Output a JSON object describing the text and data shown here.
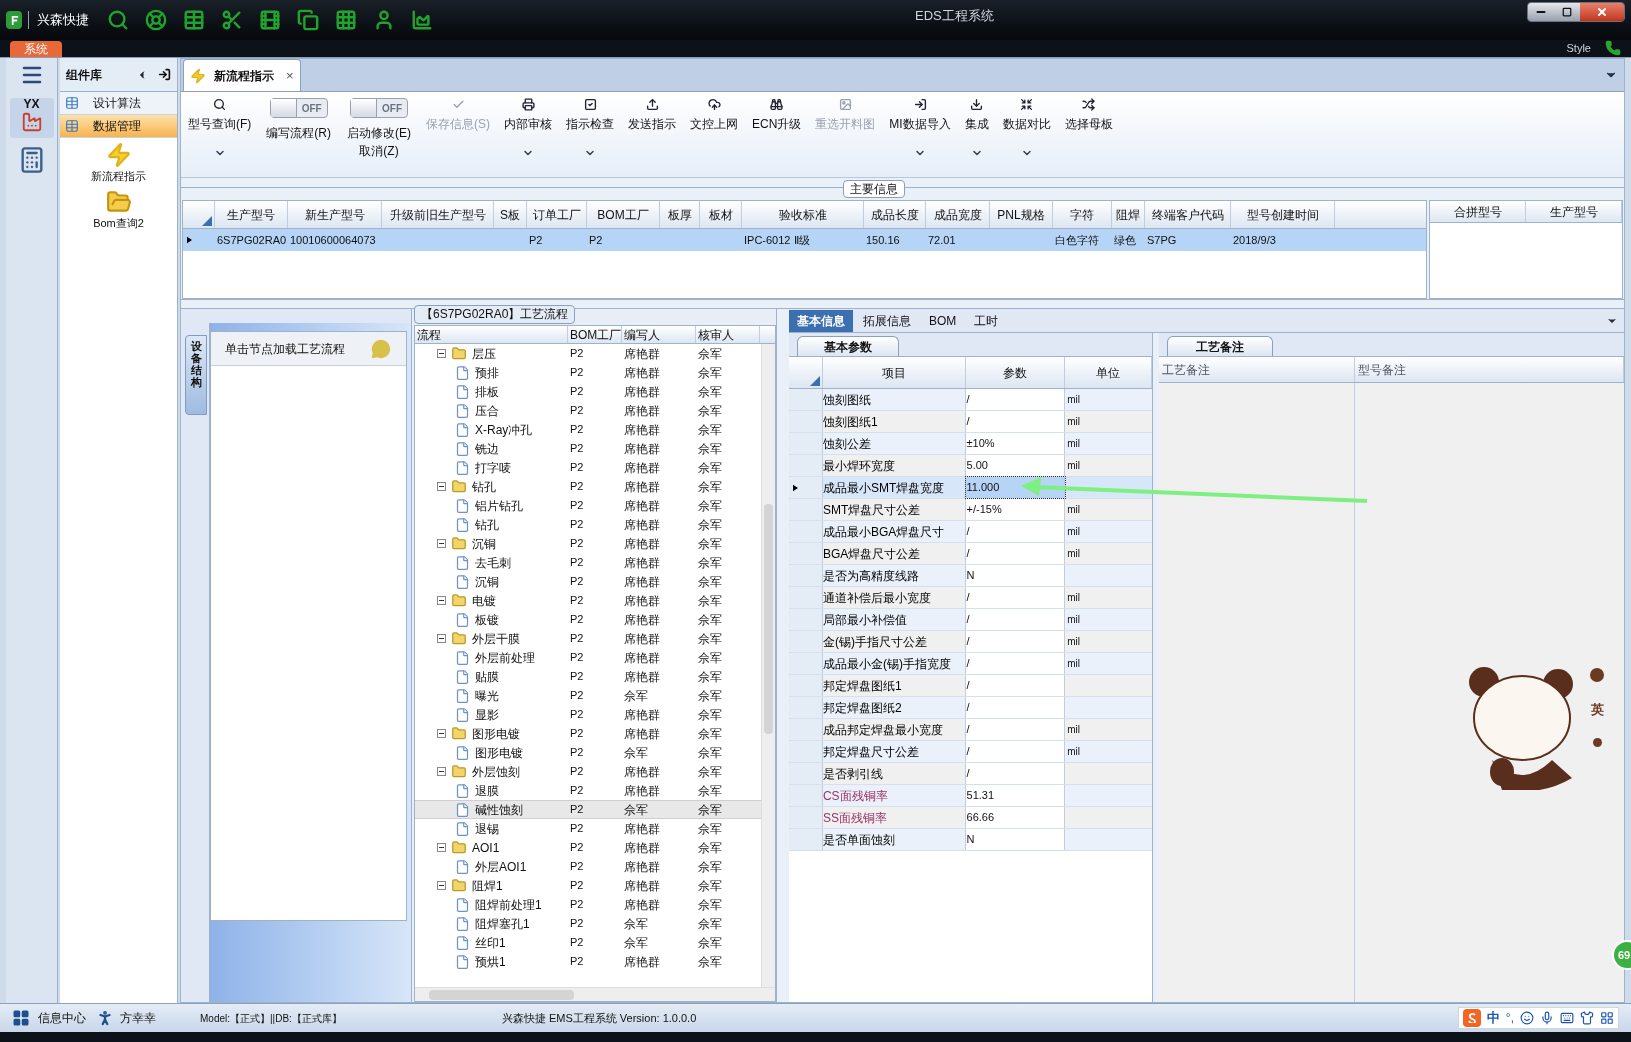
{
  "app": {
    "name": "兴森快捷",
    "window_title": "EDS工程系统",
    "system_tab": "系统",
    "style_label": "Style"
  },
  "left_rail": {
    "logo_text": "YX"
  },
  "sidebar": {
    "title": "组件库",
    "items": [
      {
        "label": "设计算法",
        "selected": false
      },
      {
        "label": "数据管理",
        "selected": true
      }
    ],
    "tools": [
      "新流程指示",
      "Bom查询2"
    ]
  },
  "doc_tab": {
    "label": "新流程指示",
    "close": "×"
  },
  "toolbar": [
    {
      "kind": "button",
      "label": "型号查询(F)",
      "disabled": false,
      "dropdown": true
    },
    {
      "kind": "toggle",
      "label": "编写流程(R)",
      "on": false,
      "state_text": "OFF"
    },
    {
      "kind": "toggle",
      "label": "启动修改(E)",
      "sublabel": "取消(Z)",
      "on": false,
      "state_text": "OFF"
    },
    {
      "kind": "button",
      "label": "保存信息(S)",
      "disabled": true,
      "dropdown": false
    },
    {
      "kind": "button",
      "label": "内部审核",
      "disabled": false,
      "dropdown": true
    },
    {
      "kind": "button",
      "label": "指示检查",
      "disabled": false,
      "dropdown": true
    },
    {
      "kind": "button",
      "label": "发送指示",
      "disabled": false,
      "dropdown": false
    },
    {
      "kind": "button",
      "label": "文控上网",
      "disabled": false,
      "dropdown": false
    },
    {
      "kind": "button",
      "label": "ECN升级",
      "disabled": false,
      "dropdown": false
    },
    {
      "kind": "button",
      "label": "重选开料图",
      "disabled": true,
      "dropdown": false
    },
    {
      "kind": "button",
      "label": "MI数据导入",
      "disabled": false,
      "dropdown": true
    },
    {
      "kind": "button",
      "label": "集成",
      "disabled": false,
      "dropdown": true
    },
    {
      "kind": "button",
      "label": "数据对比",
      "disabled": false,
      "dropdown": true
    },
    {
      "kind": "button",
      "label": "选择母板",
      "disabled": false,
      "dropdown": false
    }
  ],
  "main_info": {
    "title": "主要信息",
    "columns": [
      "生产型号",
      "新生产型号",
      "升级前旧生产型号",
      "S板",
      "订单工厂",
      "BOM工厂",
      "板厚",
      "板材",
      "验收标准",
      "成品长度",
      "成品宽度",
      "PNL规格",
      "字符",
      "阻焊",
      "终端客户代码",
      "型号创建时间"
    ],
    "rows": [
      {
        "selected": true,
        "cells": [
          "6S7PG02RA0",
          "10010600064073",
          null,
          null,
          "P2",
          "P2",
          null,
          null,
          "IPC-6012 Ⅱ级",
          "150.16",
          "72.01",
          null,
          "白色字符",
          "绿色",
          "S7PG",
          "2018/9/3"
        ]
      }
    ],
    "side_columns": [
      "合拼型号",
      "生产型号"
    ]
  },
  "process": {
    "side_tab": "设备结构",
    "hint": "单击节点加载工艺流程",
    "title": "【6S7PG02RA0】工艺流程",
    "columns": [
      "流程",
      "BOM工厂",
      "编写人",
      "核审人"
    ],
    "nodes": [
      {
        "label": "层压",
        "bom": "P2",
        "writer": "席艳群",
        "reviewer": "佘军",
        "expanded": true,
        "selected": false,
        "children": [
          {
            "label": "预排",
            "bom": "P2",
            "writer": "席艳群",
            "reviewer": "佘军",
            "selected": false
          },
          {
            "label": "排板",
            "bom": "P2",
            "writer": "席艳群",
            "reviewer": "佘军",
            "selected": false
          },
          {
            "label": "压合",
            "bom": "P2",
            "writer": "席艳群",
            "reviewer": "佘军",
            "selected": false
          },
          {
            "label": "X-Ray冲孔",
            "bom": "P2",
            "writer": "席艳群",
            "reviewer": "佘军",
            "selected": false
          },
          {
            "label": "铣边",
            "bom": "P2",
            "writer": "席艳群",
            "reviewer": "佘军",
            "selected": false
          },
          {
            "label": "打字唛",
            "bom": "P2",
            "writer": "席艳群",
            "reviewer": "佘军",
            "selected": false
          }
        ]
      },
      {
        "label": "钻孔",
        "bom": "P2",
        "writer": "席艳群",
        "reviewer": "佘军",
        "expanded": true,
        "selected": false,
        "children": [
          {
            "label": "铝片钻孔",
            "bom": "P2",
            "writer": "席艳群",
            "reviewer": "佘军",
            "selected": false
          },
          {
            "label": "钻孔",
            "bom": "P2",
            "writer": "席艳群",
            "reviewer": "佘军",
            "selected": false
          }
        ]
      },
      {
        "label": "沉铜",
        "bom": "P2",
        "writer": "席艳群",
        "reviewer": "佘军",
        "expanded": true,
        "selected": false,
        "children": [
          {
            "label": "去毛刺",
            "bom": "P2",
            "writer": "席艳群",
            "reviewer": "佘军",
            "selected": false
          },
          {
            "label": "沉铜",
            "bom": "P2",
            "writer": "席艳群",
            "reviewer": "佘军",
            "selected": false
          }
        ]
      },
      {
        "label": "电镀",
        "bom": "P2",
        "writer": "席艳群",
        "reviewer": "佘军",
        "expanded": true,
        "selected": false,
        "children": [
          {
            "label": "板镀",
            "bom": "P2",
            "writer": "席艳群",
            "reviewer": "佘军",
            "selected": false
          }
        ]
      },
      {
        "label": "外层干膜",
        "bom": "P2",
        "writer": "席艳群",
        "reviewer": "佘军",
        "expanded": true,
        "selected": false,
        "children": [
          {
            "label": "外层前处理",
            "bom": "P2",
            "writer": "席艳群",
            "reviewer": "佘军",
            "selected": false
          },
          {
            "label": "贴膜",
            "bom": "P2",
            "writer": "席艳群",
            "reviewer": "佘军",
            "selected": false
          },
          {
            "label": "曝光",
            "bom": "P2",
            "writer": "佘军",
            "reviewer": "佘军",
            "selected": false
          },
          {
            "label": "显影",
            "bom": "P2",
            "writer": "席艳群",
            "reviewer": "佘军",
            "selected": false
          }
        ]
      },
      {
        "label": "图形电镀",
        "bom": "P2",
        "writer": "席艳群",
        "reviewer": "佘军",
        "expanded": true,
        "selected": false,
        "children": [
          {
            "label": "图形电镀",
            "bom": "P2",
            "writer": "佘军",
            "reviewer": "佘军",
            "selected": false
          }
        ]
      },
      {
        "label": "外层蚀刻",
        "bom": "P2",
        "writer": "席艳群",
        "reviewer": "佘军",
        "expanded": true,
        "selected": false,
        "children": [
          {
            "label": "退膜",
            "bom": "P2",
            "writer": "席艳群",
            "reviewer": "佘军",
            "selected": false
          },
          {
            "label": "碱性蚀刻",
            "bom": "P2",
            "writer": "佘军",
            "reviewer": "佘军",
            "selected": true
          },
          {
            "label": "退锡",
            "bom": "P2",
            "writer": "席艳群",
            "reviewer": "佘军",
            "selected": false
          }
        ]
      },
      {
        "label": "AOI1",
        "bom": "P2",
        "writer": "席艳群",
        "reviewer": "佘军",
        "expanded": true,
        "selected": false,
        "children": [
          {
            "label": "外层AOI1",
            "bom": "P2",
            "writer": "席艳群",
            "reviewer": "佘军",
            "selected": false
          }
        ]
      },
      {
        "label": "阻焊1",
        "bom": "P2",
        "writer": "席艳群",
        "reviewer": "佘军",
        "expanded": true,
        "selected": false,
        "children": [
          {
            "label": "阻焊前处理1",
            "bom": "P2",
            "writer": "席艳群",
            "reviewer": "佘军",
            "selected": false
          },
          {
            "label": "阻焊塞孔1",
            "bom": "P2",
            "writer": "佘军",
            "reviewer": "佘军",
            "selected": false
          },
          {
            "label": "丝印1",
            "bom": "P2",
            "writer": "佘军",
            "reviewer": "佘军",
            "selected": false
          },
          {
            "label": "预烘1",
            "bom": "P2",
            "writer": "席艳群",
            "reviewer": "佘军",
            "selected": false
          }
        ]
      }
    ]
  },
  "detail_tabs": [
    {
      "label": "基本信息",
      "selected": true
    },
    {
      "label": "拓展信息",
      "selected": false
    },
    {
      "label": "BOM",
      "selected": false
    },
    {
      "label": "工时",
      "selected": false
    }
  ],
  "params": {
    "tab": "基本参数",
    "columns": [
      "项目",
      "参数",
      "单位"
    ],
    "rows": [
      {
        "item": "蚀刻图纸",
        "value": "/",
        "unit": "mil",
        "selected": false,
        "kind": "plain"
      },
      {
        "item": "蚀刻图纸1",
        "value": "/",
        "unit": "mil",
        "selected": false,
        "kind": "plain"
      },
      {
        "item": "蚀刻公差",
        "value": "±10%",
        "unit": "mil",
        "selected": false,
        "kind": "plain"
      },
      {
        "item": "最小焊环宽度",
        "value": "5.00",
        "unit": "mil",
        "selected": false,
        "kind": "plain"
      },
      {
        "item": "成品最小SMT焊盘宽度",
        "value": "11.000",
        "selected": true,
        "kind": "plain"
      },
      {
        "item": "SMT焊盘尺寸公差",
        "value": "+/-15%",
        "unit": "mil",
        "selected": false,
        "kind": "plain"
      },
      {
        "item": "成品最小BGA焊盘尺寸",
        "value": "/",
        "unit": "mil",
        "selected": false,
        "kind": "plain"
      },
      {
        "item": "BGA焊盘尺寸公差",
        "value": "/",
        "unit": "mil",
        "selected": false,
        "kind": "plain"
      },
      {
        "item": "是否为高精度线路",
        "value": "N",
        "selected": false,
        "kind": "plain"
      },
      {
        "item": "通道补偿后最小宽度",
        "value": "/",
        "unit": "mil",
        "selected": false,
        "kind": "plain"
      },
      {
        "item": "局部最小补偿值",
        "value": "/",
        "unit": "mil",
        "selected": false,
        "kind": "plain"
      },
      {
        "item": "金(锡)手指尺寸公差",
        "value": "/",
        "unit": "mil",
        "selected": false,
        "kind": "plain"
      },
      {
        "item": "成品最小金(锡)手指宽度",
        "value": "/",
        "unit": "mil",
        "selected": false,
        "kind": "plain"
      },
      {
        "item": "邦定焊盘图纸1",
        "value": "/",
        "selected": false,
        "kind": "plain"
      },
      {
        "item": "邦定焊盘图纸2",
        "value": "/",
        "selected": false,
        "kind": "plain"
      },
      {
        "item": "成品邦定焊盘最小宽度",
        "value": "/",
        "unit": "mil",
        "selected": false,
        "kind": "plain"
      },
      {
        "item": "邦定焊盘尺寸公差",
        "value": "/",
        "unit": "mil",
        "selected": false,
        "kind": "plain"
      },
      {
        "item": "是否剥引线",
        "value": "/",
        "selected": false,
        "kind": "plain"
      },
      {
        "item": "CS面残铜率",
        "value": "51.31",
        "selected": false,
        "kind": "computed"
      },
      {
        "item": "SS面残铜率",
        "value": "66.66",
        "selected": false,
        "kind": "computed"
      },
      {
        "item": "是否单面蚀刻",
        "value": "N",
        "selected": false,
        "kind": "plain"
      }
    ]
  },
  "notes": {
    "tab": "工艺备注",
    "columns": [
      "工艺备注",
      "型号备注"
    ]
  },
  "mascot": {
    "side_text": "英"
  },
  "badge": "69",
  "status_bar": {
    "info_center": "信息中心",
    "user": "方幸幸",
    "model": "Model:【正式】||DB:【正式库】",
    "center": "兴森快捷 EMS工程系统 Version: 1.0.0.0"
  },
  "ime": {
    "lang": "中",
    "punct": "°,"
  }
}
